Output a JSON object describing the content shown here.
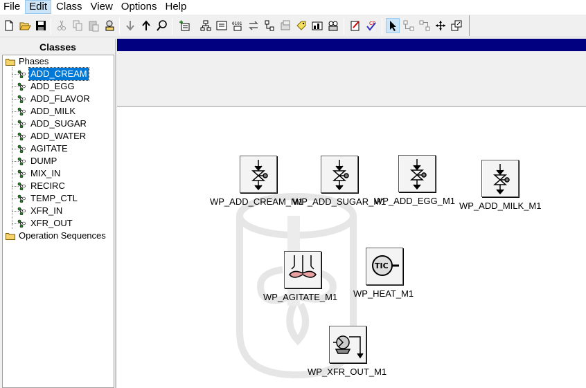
{
  "menu": [
    "File",
    "Edit",
    "Class",
    "View",
    "Options",
    "Help"
  ],
  "menu_active": "Edit",
  "toolbar_icons": [
    "new-file-icon",
    "open-folder-icon",
    "save-icon",
    "cut-icon",
    "copy-icon",
    "paste-icon",
    "properties-icon",
    "move-down-icon",
    "move-up-icon",
    "find-icon",
    "insert-icon",
    "hierarchy-icon",
    "form-icon",
    "binary-icon",
    "swap-icon",
    "network-icon",
    "grid-icon",
    "tag-icon",
    "chart-icon",
    "group-icon",
    "edit-doc-icon",
    "verify-icon",
    "pointer-icon",
    "link-icon",
    "connect-icon",
    "expand-icon",
    "zoom-window-icon"
  ],
  "classes_panel": {
    "title": "Classes",
    "phases_label": "Phases",
    "phases": [
      "ADD_CREAM",
      "ADD_EGG",
      "ADD_FLAVOR",
      "ADD_MILK",
      "ADD_SUGAR",
      "ADD_WATER",
      "AGITATE",
      "DUMP",
      "MIX_IN",
      "RECIRC",
      "TEMP_CTL",
      "XFR_IN",
      "XFR_OUT"
    ],
    "selected": "ADD_CREAM",
    "operation_sequences_label": "Operation Sequences"
  },
  "canvas_blocks": [
    {
      "label": "WP_ADD_CREAM_M1",
      "icon": "valve-icon"
    },
    {
      "label": "WP_ADD_SUGAR_M1",
      "icon": "valve-icon"
    },
    {
      "label": "WP_ADD_EGG_M1",
      "icon": "valve-icon"
    },
    {
      "label": "WP_ADD_MILK_M1",
      "icon": "valve-icon"
    },
    {
      "label": "WP_AGITATE_M1",
      "icon": "agitator-icon"
    },
    {
      "label": "WP_HEAT_M1",
      "icon": "tic-controller-icon"
    },
    {
      "label": "WP_XFR_OUT_M1",
      "icon": "pump-icon"
    }
  ],
  "tic_text": "TIC",
  "colors": {
    "selection": "#0078d7",
    "title_strip": "#000080",
    "agitator_blade": "#e8a0a0"
  }
}
